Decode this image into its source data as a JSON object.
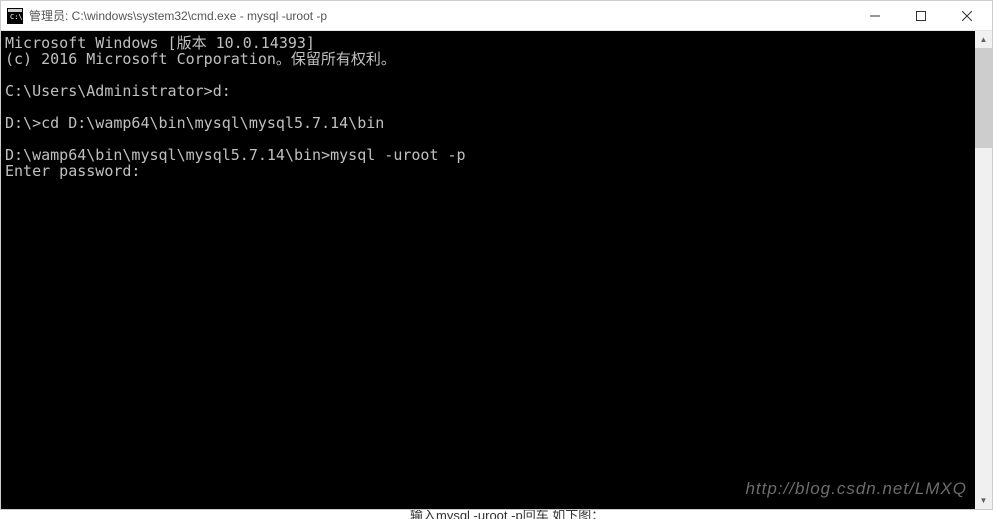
{
  "window": {
    "title": "管理员: C:\\windows\\system32\\cmd.exe - mysql  -uroot -p"
  },
  "terminal": {
    "lines": [
      "Microsoft Windows [版本 10.0.14393]",
      "(c) 2016 Microsoft Corporation。保留所有权利。",
      "",
      "C:\\Users\\Administrator>d:",
      "",
      "D:\\>cd D:\\wamp64\\bin\\mysql\\mysql5.7.14\\bin",
      "",
      "D:\\wamp64\\bin\\mysql\\mysql5.7.14\\bin>mysql -uroot -p",
      "Enter password:"
    ]
  },
  "watermark": "http://blog.csdn.net/LMXQ",
  "footer_fragment": "输入mysql -uroot -p回车 如下图："
}
